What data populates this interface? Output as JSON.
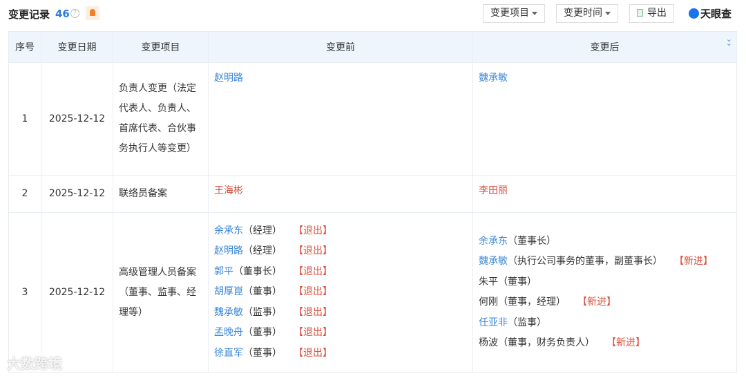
{
  "header": {
    "title": "变更记录",
    "count": "46",
    "help_icon": "?",
    "buttons": {
      "item_filter": "变更项目",
      "time_filter": "变更时间",
      "export": "导出"
    },
    "logo": "天眼查"
  },
  "table": {
    "columns": [
      "序号",
      "变更日期",
      "变更项目",
      "变更前",
      "变更后"
    ],
    "rows": [
      {
        "no": "1",
        "date": "2025-12-12",
        "item": "负责人变更（法定代表人、负责人、首席代表、合伙事务执行人等变更）",
        "before": [
          {
            "name": "赵明路",
            "role": "",
            "tag": ""
          }
        ],
        "after": [
          {
            "name": "魏承敏",
            "role": "",
            "tag": ""
          }
        ]
      },
      {
        "no": "2",
        "date": "2025-12-12",
        "item": "联络员备案",
        "before": [
          {
            "name": "王海彬",
            "role": "",
            "tag": ""
          }
        ],
        "after": [
          {
            "name": "李田丽",
            "role": "",
            "tag": ""
          }
        ]
      },
      {
        "no": "3",
        "date": "2025-12-12",
        "item": "高级管理人员备案（董事、监事、经理等）",
        "before": [
          {
            "name": "余承东",
            "role": "（经理）",
            "tag": "【退出】"
          },
          {
            "name": "赵明路",
            "role": "（经理）",
            "tag": "【退出】"
          },
          {
            "name": "郭平",
            "role": "（董事长）",
            "tag": "【退出】"
          },
          {
            "name": "胡厚崑",
            "role": "（董事）",
            "tag": "【退出】"
          },
          {
            "name": "魏承敏",
            "role": "（监事）",
            "tag": "【退出】"
          },
          {
            "name": "孟晚舟",
            "role": "（董事）",
            "tag": "【退出】"
          },
          {
            "name": "徐直军",
            "role": "（董事）",
            "tag": "【退出】"
          }
        ],
        "after": [
          {
            "name": "余承东",
            "role": "（董事长）",
            "tag": ""
          },
          {
            "name": "魏承敏",
            "role": "（执行公司事务的董事，副董事长）",
            "tag": "【新进】"
          },
          {
            "name": "朱平",
            "role": "（董事）",
            "tag": ""
          },
          {
            "name": "何刚",
            "role": "（董事，经理）",
            "tag": "【新进】"
          },
          {
            "name": "任亚非",
            "role": "（监事）",
            "tag": ""
          },
          {
            "name": "杨波",
            "role": "（董事，财务负责人）",
            "tag": "【新进】"
          }
        ]
      }
    ]
  },
  "watermark": "大数跨境"
}
